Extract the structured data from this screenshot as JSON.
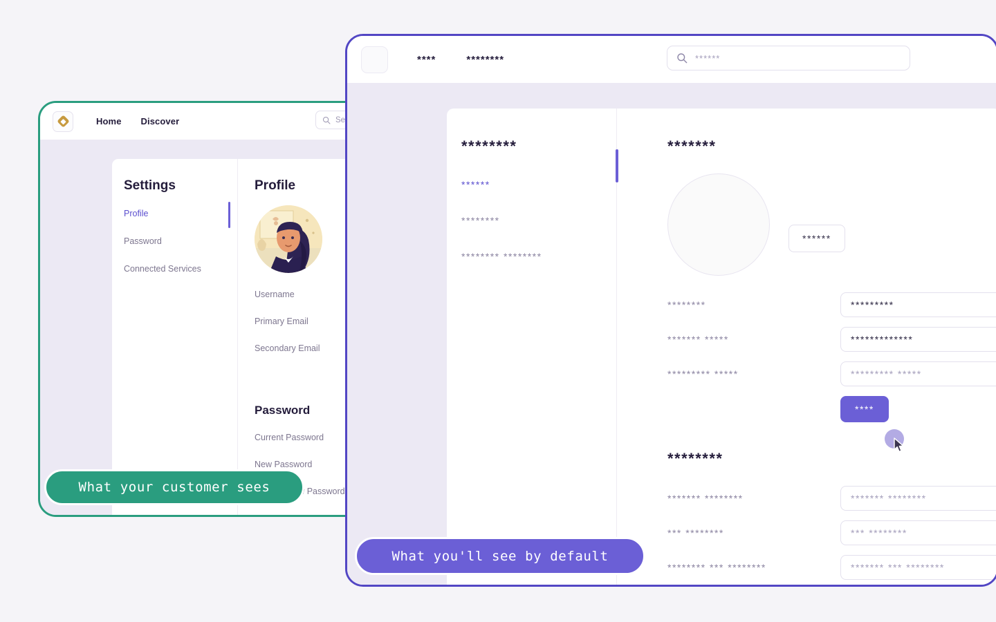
{
  "page": {
    "background_color": "#f5f4f8"
  },
  "left_card": {
    "accent_color": "#2a9d7f",
    "logo_icon": "diamond-logo-icon",
    "nav": [
      "Home",
      "Discover"
    ],
    "search": {
      "icon": "search-icon",
      "placeholder": "Search",
      "value": ""
    },
    "settings": {
      "title": "Settings",
      "items": [
        {
          "label": "Profile",
          "active": true
        },
        {
          "label": "Password",
          "active": false
        },
        {
          "label": "Connected Services",
          "active": false
        }
      ]
    },
    "profile": {
      "title": "Profile",
      "avatar_icon": "user-avatar-illustration",
      "fields": [
        "Username",
        "Primary Email",
        "Secondary Email"
      ]
    },
    "password": {
      "title": "Password",
      "fields": [
        "Current Password",
        "New Password",
        "Confirm New Password"
      ]
    }
  },
  "right_card": {
    "accent_color": "#5246c4",
    "logo_icon": "app-logo-icon",
    "nav": [
      "****",
      "********"
    ],
    "search": {
      "icon": "search-icon",
      "placeholder": "******",
      "value": ""
    },
    "settings": {
      "title": "********",
      "items": [
        {
          "label": "******",
          "active": true
        },
        {
          "label": "********",
          "active": false
        },
        {
          "label": "******** ********",
          "active": false
        }
      ]
    },
    "profile": {
      "title": "*******",
      "avatar_icon": "avatar-placeholder-icon",
      "upload_button": "******",
      "fields": [
        {
          "label": "********",
          "value": "*********",
          "muted": false
        },
        {
          "label": "******* *****",
          "value": "*************",
          "muted": false
        },
        {
          "label": "********* *****",
          "value": "********* *****",
          "muted": true
        }
      ],
      "save_button": "****"
    },
    "password": {
      "title": "********",
      "fields": [
        {
          "label": "******* ********",
          "value": "******* ********",
          "muted": true
        },
        {
          "label": "*** ********",
          "value": "*** ********",
          "muted": true
        },
        {
          "label": "******** *** ********",
          "value": "******* *** ********",
          "muted": true
        }
      ]
    },
    "cursor": {
      "icon": "mouse-cursor-icon",
      "ripple": "click-ripple"
    }
  },
  "callouts": {
    "customer": {
      "text": "What your customer sees",
      "color": "#2a9d7f"
    },
    "default": {
      "text": "What you'll see by default",
      "color": "#6b5fd6"
    }
  }
}
